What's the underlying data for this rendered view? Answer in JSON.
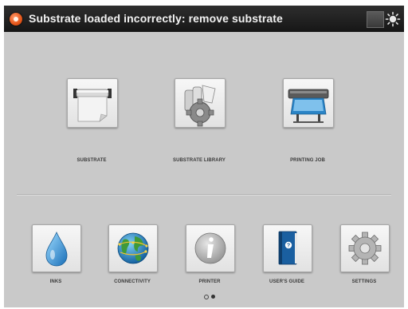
{
  "status_bar": {
    "message": "Substrate loaded incorrectly: remove substrate",
    "alert_icon": "error-icon",
    "alert_color": "#e5561a",
    "brightness_icon": "brightness-icon",
    "view_icon": "view-toggle-icon"
  },
  "main_menu": [
    {
      "label": "SUBSTRATE",
      "icon": "substrate-roll-icon"
    },
    {
      "label": "SUBSTRATE LIBRARY",
      "icon": "substrate-library-icon"
    },
    {
      "label": "PRINTING JOB",
      "icon": "printer-job-icon"
    }
  ],
  "bottom_menu": [
    {
      "label": "INKS",
      "icon": "ink-drop-icon"
    },
    {
      "label": "CONNECTIVITY",
      "icon": "globe-icon"
    },
    {
      "label": "PRINTER",
      "icon": "info-icon"
    },
    {
      "label": "USER'S GUIDE",
      "icon": "user-guide-book-icon"
    },
    {
      "label": "SETTINGS",
      "icon": "gear-icon"
    }
  ],
  "pagination": {
    "pages": 2,
    "current": 2
  }
}
